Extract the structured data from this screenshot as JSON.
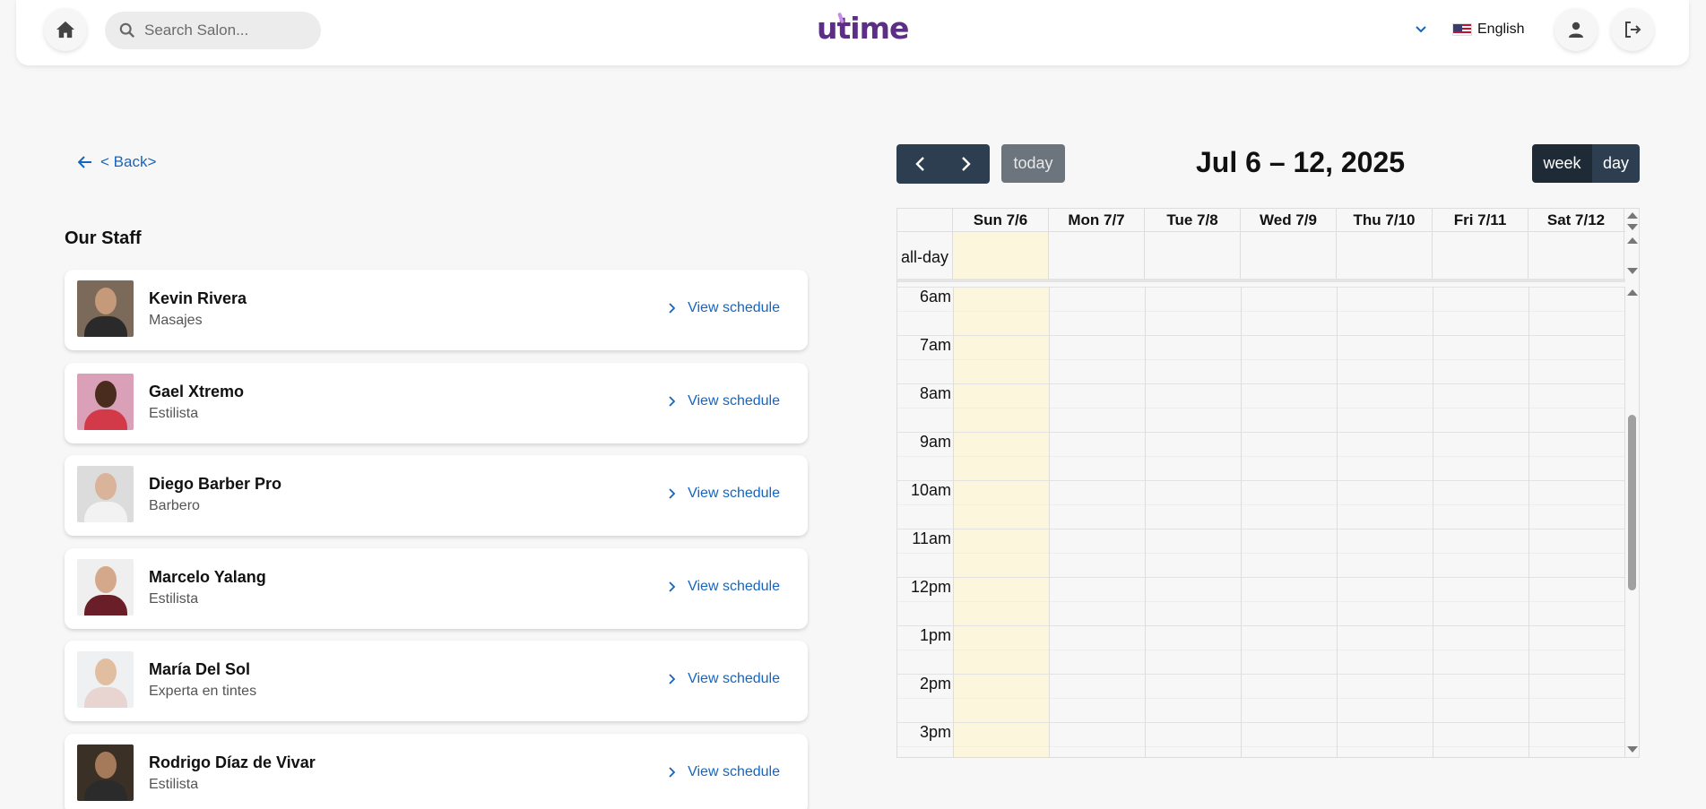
{
  "header": {
    "search_placeholder": "Search Salon...",
    "logo_text": "utime",
    "language": "English"
  },
  "back_label": "< Back>",
  "staff_title": "Our Staff",
  "schedule_label": "View schedule",
  "staff": [
    {
      "name": "Kevin Rivera",
      "role": "Masajes"
    },
    {
      "name": "Gael Xtremo",
      "role": "Estilista"
    },
    {
      "name": "Diego Barber Pro",
      "role": "Barbero"
    },
    {
      "name": "Marcelo Yalang",
      "role": "Estilista"
    },
    {
      "name": "María Del Sol",
      "role": "Experta en tintes"
    },
    {
      "name": "Rodrigo Díaz de Vivar",
      "role": "Estilista"
    }
  ],
  "calendar": {
    "title": "Jul 6 – 12, 2025",
    "today_label": "today",
    "view_week": "week",
    "view_day": "day",
    "allday_label": "all-day",
    "days": [
      "Sun 7/6",
      "Mon 7/7",
      "Tue 7/8",
      "Wed 7/9",
      "Thu 7/10",
      "Fri 7/11",
      "Sat 7/12"
    ],
    "times": [
      "6am",
      "7am",
      "8am",
      "9am",
      "10am",
      "11am",
      "12pm",
      "1pm",
      "2pm",
      "3pm"
    ]
  },
  "colors": {
    "accent": "#1565c0",
    "nav_dark": "#2c3e50",
    "today_highlight": "#fcf6dc",
    "logo": "#5b2f86"
  }
}
